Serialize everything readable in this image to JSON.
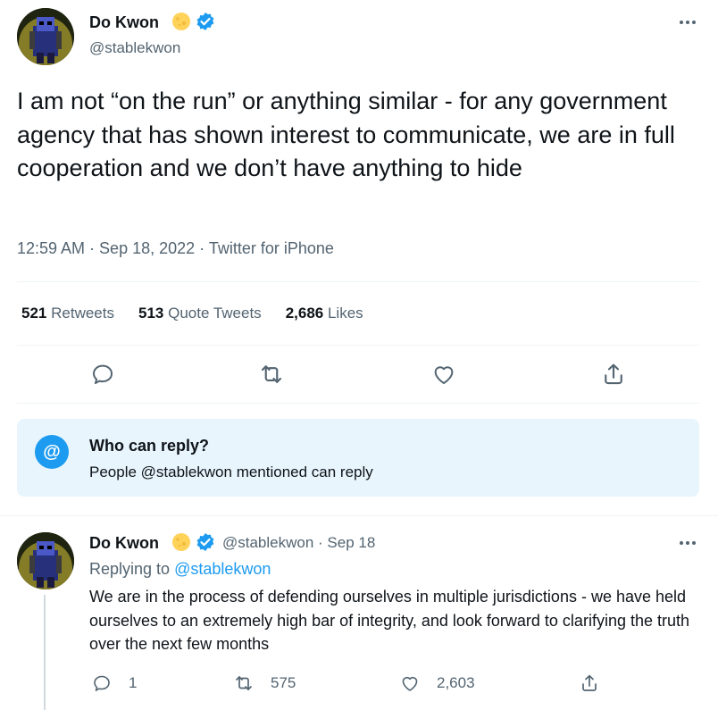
{
  "main_tweet": {
    "author_name": "Do Kwon",
    "author_handle": "@stablekwon",
    "text": "I am not “on the run” or anything similar - for any government agency that has shown interest to communicate, we are in full cooperation and we don’t have anything to hide",
    "meta": "12:59 AM · Sep 18, 2022 · Twitter for iPhone",
    "stats": [
      {
        "count": "521",
        "label": "Retweets"
      },
      {
        "count": "513",
        "label": "Quote Tweets"
      },
      {
        "count": "2,686",
        "label": "Likes"
      }
    ]
  },
  "reply_settings": {
    "icon_glyph": "@",
    "title": "Who can reply?",
    "subtitle": "People @stablekwon mentioned can reply"
  },
  "reply_tweet": {
    "author_name": "Do Kwon",
    "handle_and_date": "@stablekwon · Sep 18",
    "replying_prefix": "Replying to",
    "replying_handle": "@stablekwon",
    "text": "We are in the process of defending ourselves in multiple jurisdictions - we have held ourselves to an extremely high bar of integrity, and look forward to clarifying the truth over the next few months",
    "reply_count": "1",
    "retweet_count": "575",
    "like_count": "2,603"
  },
  "colors": {
    "accent": "#1d9bf0",
    "secondary_text": "#536471",
    "reply_box_bg": "#e8f5fd",
    "moon_badge": "#ffd25a"
  }
}
